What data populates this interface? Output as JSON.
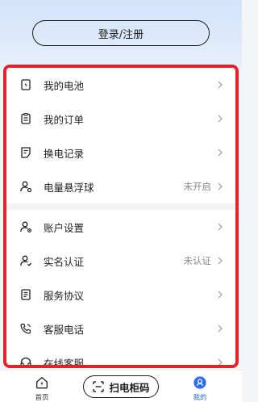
{
  "header": {
    "login_label": "登录/注册"
  },
  "menu": {
    "group1": [
      {
        "label": "我的电池",
        "status": "",
        "icon": "battery-icon"
      },
      {
        "label": "我的订单",
        "status": "",
        "icon": "clipboard-icon"
      },
      {
        "label": "换电记录",
        "status": "",
        "icon": "record-icon"
      },
      {
        "label": "电量悬浮球",
        "status": "未开启",
        "icon": "user-float-icon"
      }
    ],
    "group2": [
      {
        "label": "账户设置",
        "status": "",
        "icon": "user-settings-icon"
      },
      {
        "label": "实名认证",
        "status": "未认证",
        "icon": "user-verify-icon"
      },
      {
        "label": "服务协议",
        "status": "",
        "icon": "document-icon"
      },
      {
        "label": "客服电话",
        "status": "",
        "icon": "phone-icon"
      },
      {
        "label": "在线客服",
        "status": "",
        "icon": "headset-icon"
      }
    ]
  },
  "tabbar": {
    "home_label": "首页",
    "scan_label": "扫电柜码",
    "mine_label": "我的",
    "accent": "#2b6ef5"
  }
}
